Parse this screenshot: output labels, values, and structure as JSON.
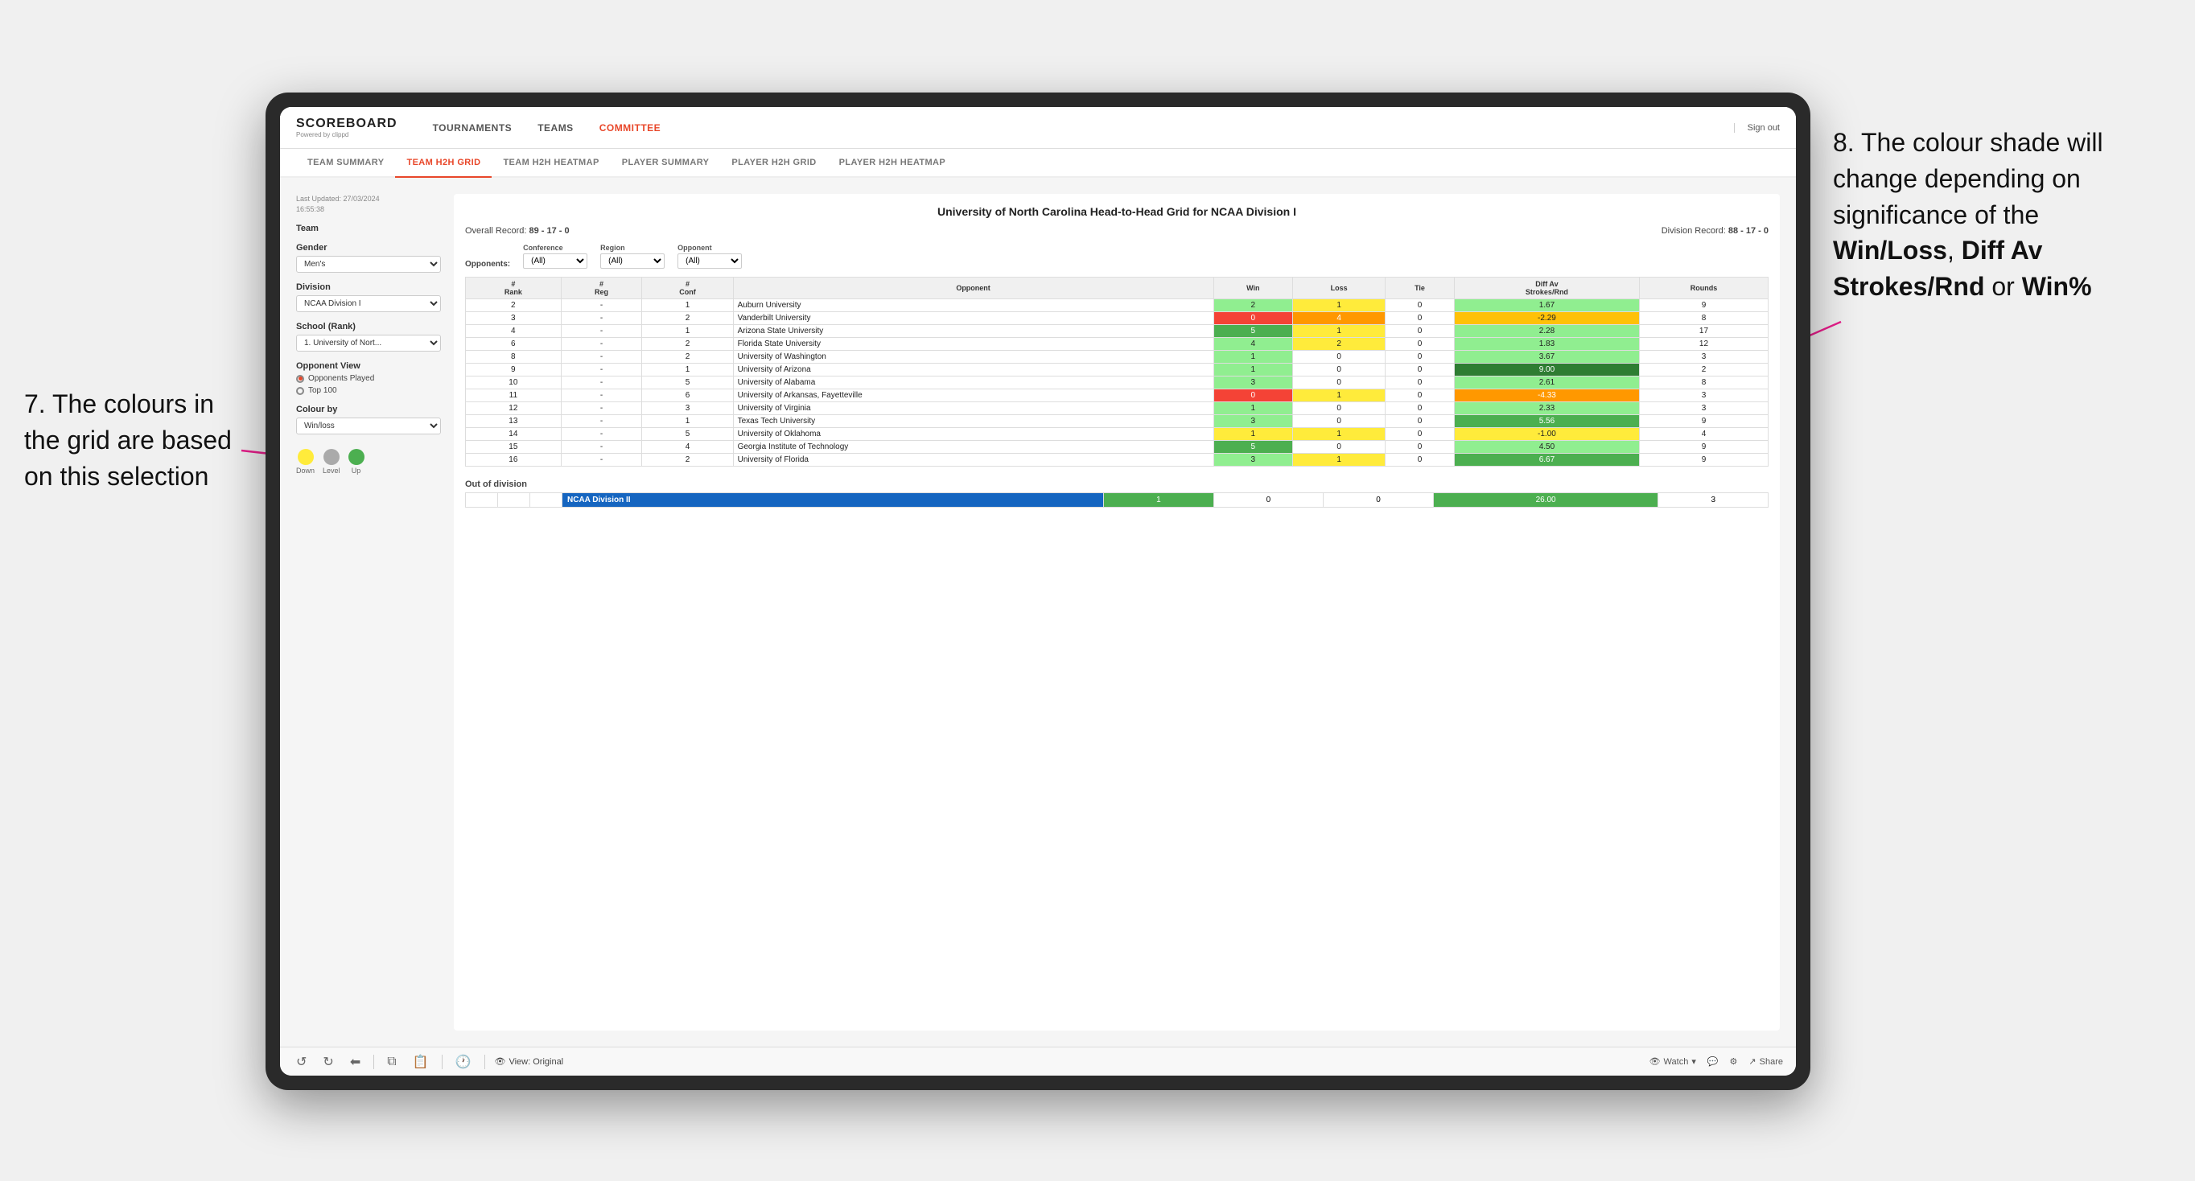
{
  "annotations": {
    "left_number": "7.",
    "left_text": "The colours in the grid are based on this selection",
    "right_number": "8.",
    "right_text": "The colour shade will change depending on significance of the",
    "right_bold1": "Win/Loss",
    "right_sep1": ", ",
    "right_bold2": "Diff Av Strokes/Rnd",
    "right_sep2": " or ",
    "right_bold3": "Win%"
  },
  "nav": {
    "logo": "SCOREBOARD",
    "logo_sub": "Powered by clippd",
    "links": [
      "TOURNAMENTS",
      "TEAMS",
      "COMMITTEE"
    ],
    "sign_out": "Sign out"
  },
  "sub_nav": {
    "items": [
      "TEAM SUMMARY",
      "TEAM H2H GRID",
      "TEAM H2H HEATMAP",
      "PLAYER SUMMARY",
      "PLAYER H2H GRID",
      "PLAYER H2H HEATMAP"
    ],
    "active": "TEAM H2H GRID"
  },
  "sidebar": {
    "last_updated_label": "Last Updated: 27/03/2024",
    "last_updated_time": "16:55:38",
    "team_label": "Team",
    "gender_label": "Gender",
    "gender_value": "Men's",
    "division_label": "Division",
    "division_value": "NCAA Division I",
    "school_label": "School (Rank)",
    "school_value": "1. University of Nort...",
    "opponent_view_label": "Opponent View",
    "opponent_played": "Opponents Played",
    "opponent_top100": "Top 100",
    "colour_by_label": "Colour by",
    "colour_by_value": "Win/loss",
    "legend": {
      "down": "Down",
      "level": "Level",
      "up": "Up"
    }
  },
  "grid": {
    "title": "University of North Carolina Head-to-Head Grid for NCAA Division I",
    "overall_record_label": "Overall Record:",
    "overall_record_value": "89 - 17 - 0",
    "division_record_label": "Division Record:",
    "division_record_value": "88 - 17 - 0",
    "filters": {
      "opponents_label": "Opponents:",
      "conference_label": "Conference",
      "conference_value": "(All)",
      "region_label": "Region",
      "region_value": "(All)",
      "opponent_label": "Opponent",
      "opponent_value": "(All)"
    },
    "table_headers": [
      "#\nRank",
      "#\nReg",
      "#\nConf",
      "Opponent",
      "Win",
      "Loss",
      "Tie",
      "Diff Av\nStrokes/Rnd",
      "Rounds"
    ],
    "rows": [
      {
        "rank": "2",
        "reg": "-",
        "conf": "1",
        "opponent": "Auburn University",
        "win": "2",
        "loss": "1",
        "tie": "0",
        "diff": "1.67",
        "rounds": "9",
        "win_color": "green_light",
        "loss_color": "yellow",
        "diff_color": "green_light"
      },
      {
        "rank": "3",
        "reg": "-",
        "conf": "2",
        "opponent": "Vanderbilt University",
        "win": "0",
        "loss": "4",
        "tie": "0",
        "diff": "-2.29",
        "rounds": "8",
        "win_color": "red",
        "loss_color": "orange",
        "diff_color": "yellow_orange"
      },
      {
        "rank": "4",
        "reg": "-",
        "conf": "1",
        "opponent": "Arizona State University",
        "win": "5",
        "loss": "1",
        "tie": "0",
        "diff": "2.28",
        "rounds": "17",
        "win_color": "green_mid",
        "loss_color": "yellow",
        "diff_color": "green_light"
      },
      {
        "rank": "6",
        "reg": "-",
        "conf": "2",
        "opponent": "Florida State University",
        "win": "4",
        "loss": "2",
        "tie": "0",
        "diff": "1.83",
        "rounds": "12",
        "win_color": "green_light",
        "loss_color": "yellow",
        "diff_color": "green_light"
      },
      {
        "rank": "8",
        "reg": "-",
        "conf": "2",
        "opponent": "University of Washington",
        "win": "1",
        "loss": "0",
        "tie": "0",
        "diff": "3.67",
        "rounds": "3",
        "win_color": "green_light",
        "loss_color": "white",
        "diff_color": "green_light"
      },
      {
        "rank": "9",
        "reg": "-",
        "conf": "1",
        "opponent": "University of Arizona",
        "win": "1",
        "loss": "0",
        "tie": "0",
        "diff": "9.00",
        "rounds": "2",
        "win_color": "green_light",
        "loss_color": "white",
        "diff_color": "green_dark"
      },
      {
        "rank": "10",
        "reg": "-",
        "conf": "5",
        "opponent": "University of Alabama",
        "win": "3",
        "loss": "0",
        "tie": "0",
        "diff": "2.61",
        "rounds": "8",
        "win_color": "green_light",
        "loss_color": "white",
        "diff_color": "green_light"
      },
      {
        "rank": "11",
        "reg": "-",
        "conf": "6",
        "opponent": "University of Arkansas, Fayetteville",
        "win": "0",
        "loss": "1",
        "tie": "0",
        "diff": "-4.33",
        "rounds": "3",
        "win_color": "red",
        "loss_color": "yellow",
        "diff_color": "orange"
      },
      {
        "rank": "12",
        "reg": "-",
        "conf": "3",
        "opponent": "University of Virginia",
        "win": "1",
        "loss": "0",
        "tie": "0",
        "diff": "2.33",
        "rounds": "3",
        "win_color": "green_light",
        "loss_color": "white",
        "diff_color": "green_light"
      },
      {
        "rank": "13",
        "reg": "-",
        "conf": "1",
        "opponent": "Texas Tech University",
        "win": "3",
        "loss": "0",
        "tie": "0",
        "diff": "5.56",
        "rounds": "9",
        "win_color": "green_light",
        "loss_color": "white",
        "diff_color": "green_mid"
      },
      {
        "rank": "14",
        "reg": "-",
        "conf": "5",
        "opponent": "University of Oklahoma",
        "win": "1",
        "loss": "1",
        "tie": "0",
        "diff": "-1.00",
        "rounds": "4",
        "win_color": "yellow",
        "loss_color": "yellow",
        "diff_color": "yellow"
      },
      {
        "rank": "15",
        "reg": "-",
        "conf": "4",
        "opponent": "Georgia Institute of Technology",
        "win": "5",
        "loss": "0",
        "tie": "0",
        "diff": "4.50",
        "rounds": "9",
        "win_color": "green_mid",
        "loss_color": "white",
        "diff_color": "green_light"
      },
      {
        "rank": "16",
        "reg": "-",
        "conf": "2",
        "opponent": "University of Florida",
        "win": "3",
        "loss": "1",
        "tie": "0",
        "diff": "6.67",
        "rounds": "9",
        "win_color": "green_light",
        "loss_color": "yellow",
        "diff_color": "green_mid"
      }
    ],
    "out_of_division_label": "Out of division",
    "out_of_division_row": {
      "label": "NCAA Division II",
      "win": "1",
      "loss": "0",
      "tie": "0",
      "diff": "26.00",
      "rounds": "3"
    }
  },
  "toolbar": {
    "view_label": "View: Original",
    "watch_label": "Watch",
    "share_label": "Share"
  },
  "colors": {
    "accent": "#e8472a",
    "green_light": "#90ee90",
    "green_mid": "#4caf50",
    "green_dark": "#2e7d32",
    "yellow": "#ffeb3b",
    "yellow_orange": "#ffc107",
    "orange": "#ff9800",
    "red": "#f44336",
    "blue_label": "#1565c0"
  }
}
